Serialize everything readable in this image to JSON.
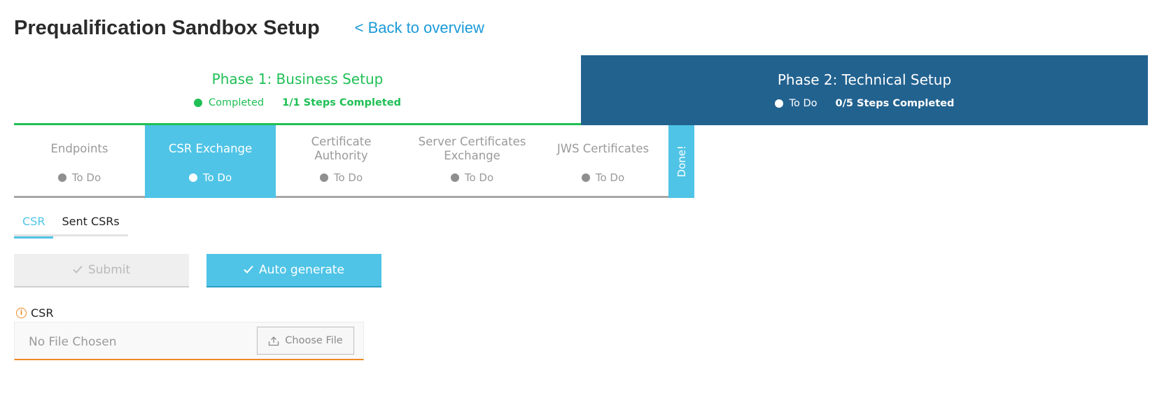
{
  "header": {
    "title": "Prequalification Sandbox Setup",
    "back_link": "< Back to overview"
  },
  "phases": [
    {
      "title": "Phase 1: Business Setup",
      "status": "Completed",
      "steps": "1/1 Steps Completed"
    },
    {
      "title": "Phase 2: Technical Setup",
      "status": "To Do",
      "steps": "0/5 Steps Completed"
    }
  ],
  "steps": [
    {
      "label": "Endpoints",
      "status": "To Do"
    },
    {
      "label": "CSR Exchange",
      "status": "To Do"
    },
    {
      "label": "Certificate Authority",
      "status": "To Do"
    },
    {
      "label": "Server Certificates Exchange",
      "status": "To Do"
    },
    {
      "label": "JWS Certificates",
      "status": "To Do"
    }
  ],
  "done_tab": "Done!",
  "subtabs": [
    "CSR",
    "Sent CSRs"
  ],
  "buttons": {
    "submit": "Submit",
    "auto_generate": "Auto generate"
  },
  "csr_field": {
    "label": "CSR",
    "placeholder": "No File Chosen",
    "choose_file": "Choose File"
  },
  "colors": {
    "brand_blue": "#1a9ad8",
    "phase_complete_green": "#1fbf55",
    "phase2_bg": "#22628f",
    "active_step_cyan": "#4fc4e6",
    "warning_orange": "#f08a24"
  },
  "icons": {
    "status_dot": "dot",
    "check": "check-icon",
    "info": "info-icon",
    "upload": "upload-icon"
  }
}
